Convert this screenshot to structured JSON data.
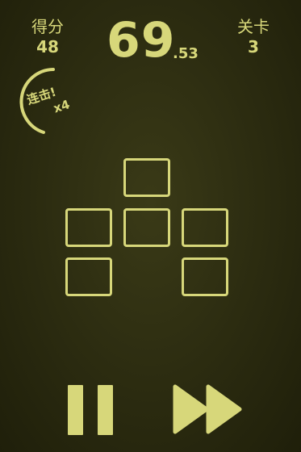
{
  "hud": {
    "score_label": "得分",
    "score_value": "48",
    "timer_main": "69",
    "timer_fraction": ".53",
    "level_label": "关卡",
    "level_value": "3"
  },
  "combo": {
    "label": "连击!",
    "multiplier": "x4"
  },
  "board": {
    "tile_count": 6
  },
  "controls": {
    "pause_icon": "pause-icon",
    "fast_forward_icon": "fast-forward-icon"
  },
  "colors": {
    "accent": "#d7d77a",
    "background": "#2b2b10"
  }
}
